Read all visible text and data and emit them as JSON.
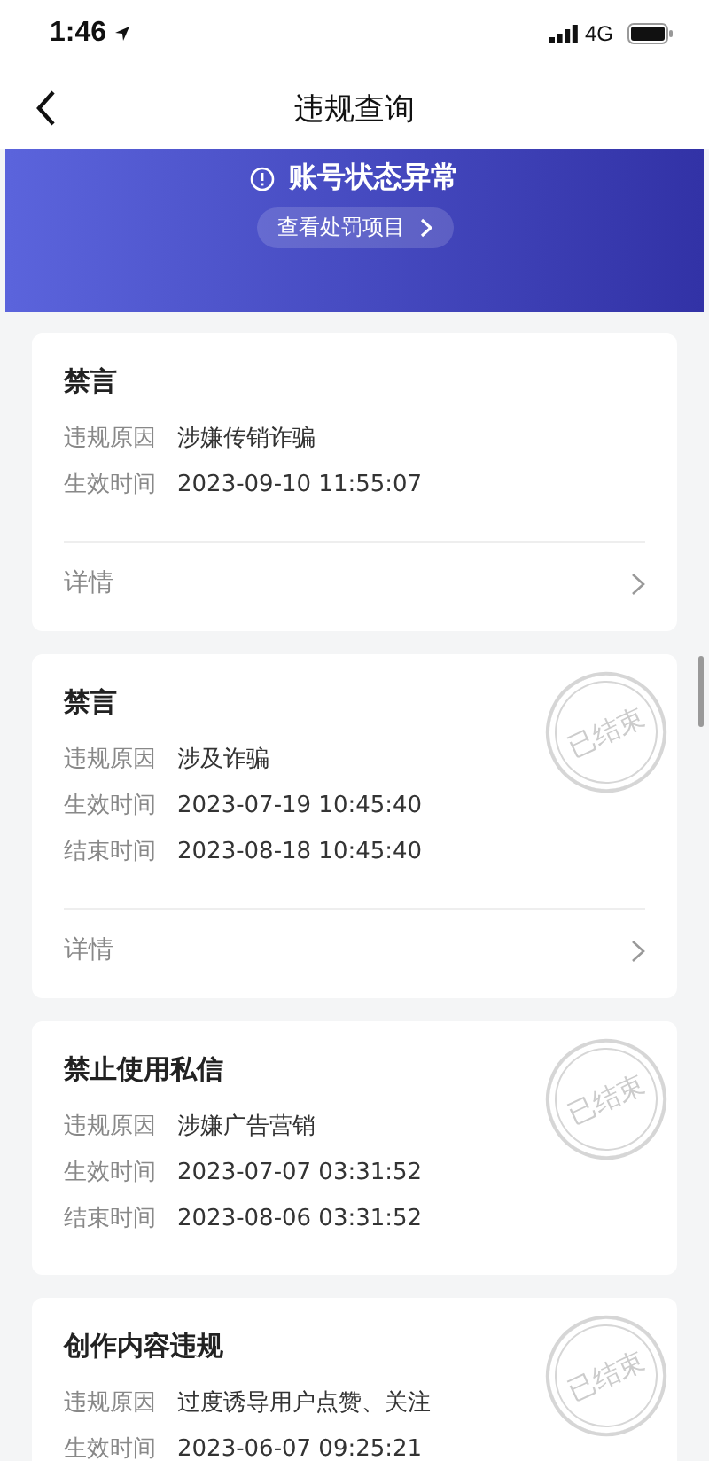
{
  "status_bar": {
    "time": "1:46",
    "network": "4G"
  },
  "nav": {
    "title": "违规查询"
  },
  "banner": {
    "status": "账号状态异常",
    "link": "查看处罚项目"
  },
  "records": [
    {
      "title": "禁言",
      "ended": false,
      "fields": [
        {
          "label": "违规原因",
          "value": "涉嫌传销诈骗"
        },
        {
          "label": "生效时间",
          "value": "2023-09-10 11:55:07"
        }
      ],
      "details": "详情"
    },
    {
      "title": "禁言",
      "ended": true,
      "stamp": "已结束",
      "fields": [
        {
          "label": "违规原因",
          "value": "涉及诈骗"
        },
        {
          "label": "生效时间",
          "value": "2023-07-19 10:45:40"
        },
        {
          "label": "结束时间",
          "value": "2023-08-18 10:45:40"
        }
      ],
      "details": "详情"
    },
    {
      "title": "禁止使用私信",
      "ended": true,
      "stamp": "已结束",
      "fields": [
        {
          "label": "违规原因",
          "value": "涉嫌广告营销"
        },
        {
          "label": "生效时间",
          "value": "2023-07-07 03:31:52"
        },
        {
          "label": "结束时间",
          "value": "2023-08-06 03:31:52"
        }
      ]
    },
    {
      "title": "创作内容违规",
      "ended": true,
      "stamp": "已结束",
      "fields": [
        {
          "label": "违规原因",
          "value": "过度诱导用户点赞、关注"
        },
        {
          "label": "生效时间",
          "value": "2023-06-07 09:25:21"
        }
      ]
    }
  ]
}
